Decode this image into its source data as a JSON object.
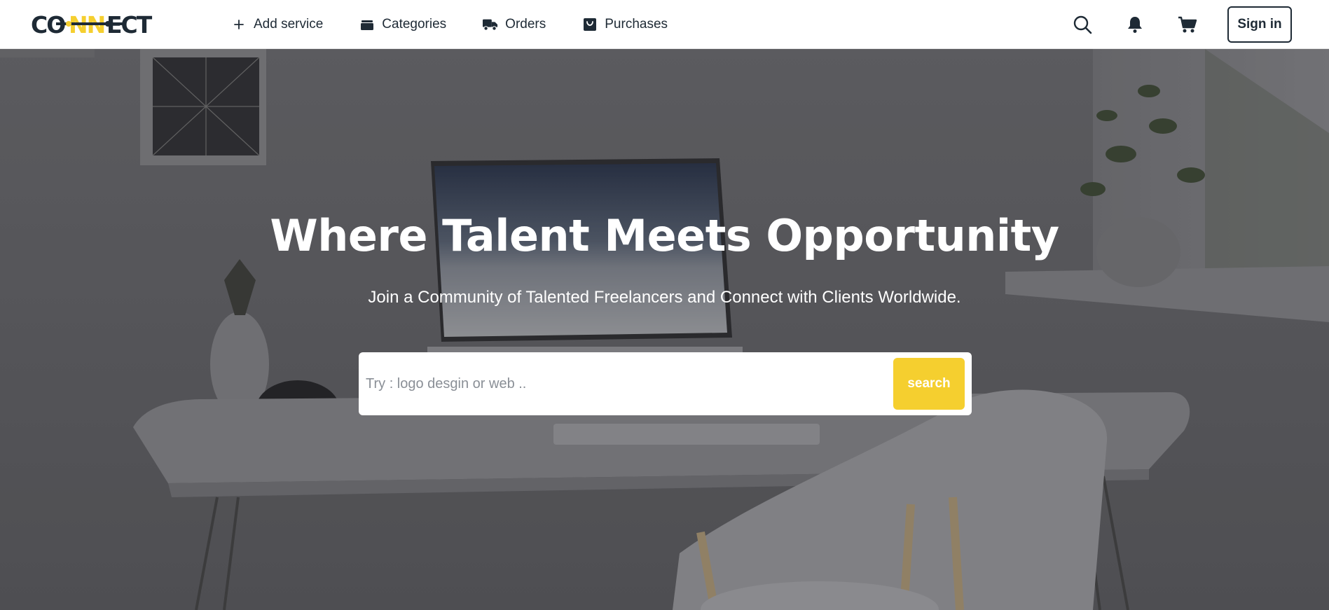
{
  "header": {
    "logo_text": "CONNECT",
    "nav": [
      {
        "label": "Add service",
        "icon": "plus-icon"
      },
      {
        "label": "Categories",
        "icon": "box-icon"
      },
      {
        "label": "Orders",
        "icon": "truck-icon"
      },
      {
        "label": "Purchases",
        "icon": "shopping-bag-icon"
      }
    ],
    "right_icons": [
      "search-icon",
      "bell-icon",
      "cart-icon"
    ],
    "signin_label": "Sign in"
  },
  "hero": {
    "title": "Where Talent Meets Opportunity",
    "subtitle": "Join a Community of Talented Freelancers and Connect with Clients Worldwide.",
    "search_placeholder": "Try : logo desgin or web ..",
    "search_button_label": "search"
  },
  "colors": {
    "brand_dark": "#1e2a35",
    "accent_yellow": "#f5cf2f",
    "header_bg": "#ffffff"
  }
}
